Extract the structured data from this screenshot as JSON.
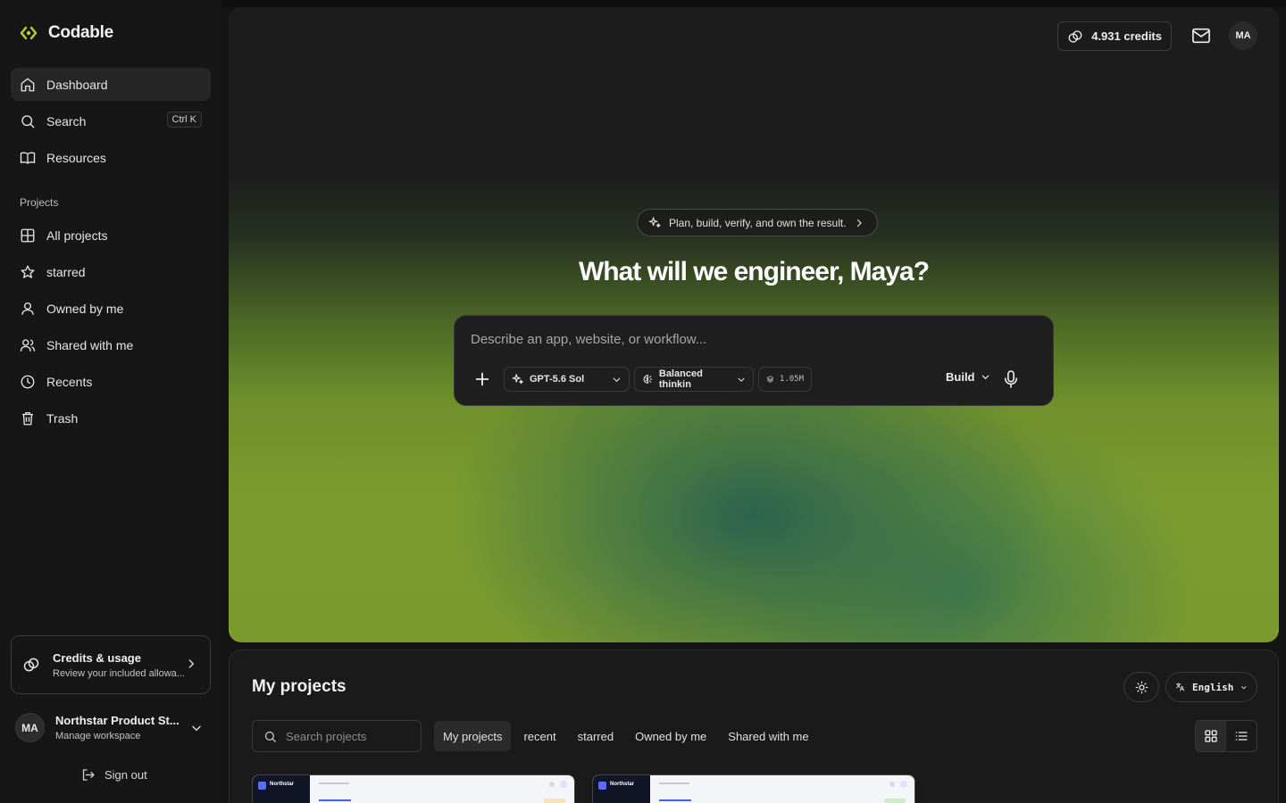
{
  "app": {
    "brand": "Codable",
    "accent_color": "#b5d334"
  },
  "sidebar": {
    "nav": [
      {
        "label": "Dashboard",
        "icon": "home-icon",
        "active": true
      },
      {
        "label": "Search",
        "icon": "search-icon",
        "shortcut": "Ctrl K"
      },
      {
        "label": "Resources",
        "icon": "book-icon"
      }
    ],
    "projects_heading": "Projects",
    "project_nav": [
      {
        "label": "All projects",
        "icon": "grid-icon"
      },
      {
        "label": "starred",
        "icon": "star-icon"
      },
      {
        "label": "Owned by me",
        "icon": "user-icon"
      },
      {
        "label": "Shared with me",
        "icon": "users-icon"
      },
      {
        "label": "Recents",
        "icon": "clock-icon"
      },
      {
        "label": "Trash",
        "icon": "trash-icon"
      }
    ],
    "credits_card": {
      "title": "Credits & usage",
      "subtitle": "Review your included allowa..."
    },
    "workspace": {
      "initials": "MA",
      "name": "Northstar Product St...",
      "subtitle": "Manage workspace"
    },
    "sign_out": "Sign out"
  },
  "header": {
    "credits": "4.931 credits",
    "avatar_initials": "MA"
  },
  "hero": {
    "announcement": "Plan, build, verify, and own the result.",
    "title": "What will we engineer, Maya?",
    "composer": {
      "placeholder": "Describe an app, website, or workflow...",
      "model": "GPT-5.6 Sol",
      "thinking": "Balanced thinkin",
      "context": "1.05M",
      "mode": "Build"
    }
  },
  "projects": {
    "title": "My projects",
    "language": "English",
    "search_placeholder": "Search projects",
    "tabs": [
      {
        "label": "My projects",
        "active": true
      },
      {
        "label": "recent"
      },
      {
        "label": "starred"
      },
      {
        "label": "Owned by me"
      },
      {
        "label": "Shared with me"
      }
    ],
    "view_mode": "grid",
    "cards": [
      {
        "brand": "Northstar",
        "tag_color": "#f7e3b0"
      },
      {
        "brand": "Northstar",
        "tag_color": "#cfeec8"
      }
    ]
  }
}
